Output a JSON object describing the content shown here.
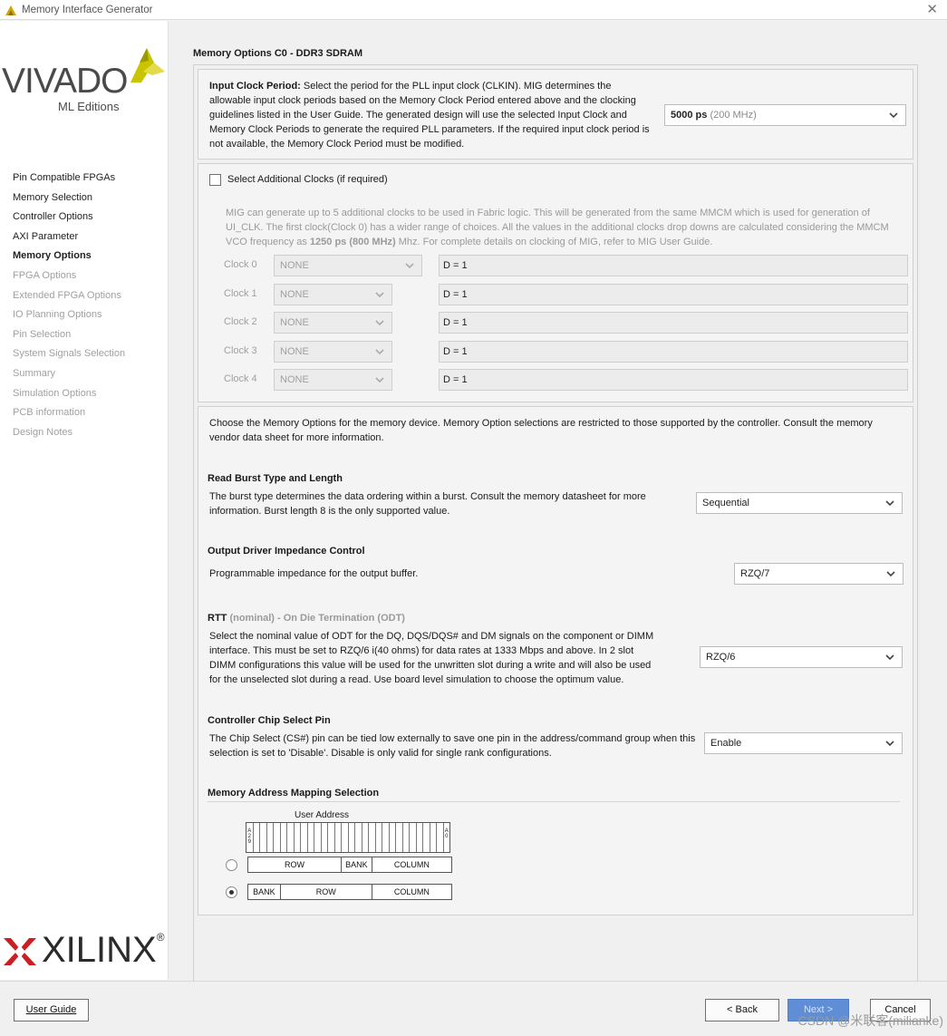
{
  "window": {
    "title": "Memory Interface Generator",
    "close_glyph": "✕"
  },
  "brand": {
    "product": "VIVADO",
    "edition": "ML Editions",
    "company": "XILINX",
    "registered": "®"
  },
  "sidebar": {
    "items": [
      {
        "label": "Pin Compatible FPGAs",
        "state": "enabled"
      },
      {
        "label": "Memory Selection",
        "state": "enabled"
      },
      {
        "label": "Controller Options",
        "state": "enabled"
      },
      {
        "label": "AXI Parameter",
        "state": "enabled"
      },
      {
        "label": "Memory Options",
        "state": "active"
      },
      {
        "label": "FPGA Options",
        "state": "disabled"
      },
      {
        "label": "Extended FPGA Options",
        "state": "disabled"
      },
      {
        "label": "IO Planning Options",
        "state": "disabled"
      },
      {
        "label": "Pin Selection",
        "state": "disabled"
      },
      {
        "label": "System Signals Selection",
        "state": "disabled"
      },
      {
        "label": "Summary",
        "state": "disabled"
      },
      {
        "label": "Simulation Options",
        "state": "disabled"
      },
      {
        "label": "PCB information",
        "state": "disabled"
      },
      {
        "label": "Design Notes",
        "state": "disabled"
      }
    ]
  },
  "page": {
    "heading": "Memory Options C0 - DDR3 SDRAM"
  },
  "input_clock": {
    "label": "Input Clock Period:",
    "description": "Select the period for the PLL input clock (CLKIN). MIG determines the allowable input clock periods based on the Memory Clock Period entered above and the clocking guidelines listed in the User Guide. The generated design will use the selected Input Clock and Memory Clock Periods to generate the required PLL parameters. If the required input clock period is not available, the Memory Clock Period must be modified.",
    "selected_value": "5000 ps",
    "selected_freq": "(200 MHz)"
  },
  "additional_clocks": {
    "checkbox_label": "Select Additional Clocks (if required)",
    "checked": false,
    "desc_part1": "MIG can generate up to 5 additional clocks to be used in Fabric logic. This will be generated from the same MMCM which is used for generation of UI_CLK. The first clock(Clock 0) has a wider range of choices. All the values in the additional clocks drop downs are calculated considering the MMCM VCO frequency as ",
    "desc_bold": "1250 ps (800 MHz)",
    "desc_part2": " Mhz. For complete details on clocking of MIG, refer to MIG User Guide.",
    "clocks": [
      {
        "label": "Clock 0",
        "value": "NONE",
        "divider": "D = 1"
      },
      {
        "label": "Clock 1",
        "value": "NONE",
        "divider": "D = 1"
      },
      {
        "label": "Clock 2",
        "value": "NONE",
        "divider": "D = 1"
      },
      {
        "label": "Clock 3",
        "value": "NONE",
        "divider": "D = 1"
      },
      {
        "label": "Clock 4",
        "value": "NONE",
        "divider": "D = 1"
      }
    ]
  },
  "memory_options": {
    "intro": "Choose the Memory Options for the memory device. Memory Option selections are restricted to those supported by the controller. Consult the memory vendor data sheet for more information.",
    "read_burst": {
      "title": "Read Burst Type and Length",
      "description": "The burst type determines the data ordering within a burst. Consult the memory datasheet for more information. Burst length 8 is the only supported value.",
      "value": "Sequential"
    },
    "output_driver": {
      "title": "Output Driver Impedance Control",
      "description": "Programmable impedance for the output buffer.",
      "value": "RZQ/7"
    },
    "rtt": {
      "title": "RTT",
      "title_suffix": " (nominal) - On Die Termination (ODT)",
      "description": "Select the nominal value of ODT for the DQ, DQS/DQS# and DM signals on the component or DIMM interface. This must be set to RZQ/6 i(40 ohms) for data rates at 1333 Mbps and above. In 2 slot DIMM configurations this value will be used for the unwritten slot during a write and will also be used for the unselected slot during a read. Use board level simulation to choose the optimum value.",
      "value": "RZQ/6"
    },
    "chip_select": {
      "title": "Controller Chip Select Pin",
      "description": "The Chip Select (CS#) pin can be tied low externally to save one pin in the address/command group when this selection is set to 'Disable'. Disable is only valid for single rank configurations.",
      "value": "Enable"
    },
    "address_mapping": {
      "title": "Memory Address Mapping Selection",
      "user_address_label": "User Address",
      "msb_label": "A29",
      "lsb_label": "A0",
      "bit_count": 30,
      "options": [
        {
          "selected": false,
          "segments": [
            "ROW",
            "BANK",
            "COLUMN"
          ]
        },
        {
          "selected": true,
          "segments": [
            "BANK",
            "ROW",
            "COLUMN"
          ]
        }
      ]
    }
  },
  "footer": {
    "user_guide": "User Guide",
    "back": "< Back",
    "next": "Next >",
    "cancel": "Cancel"
  },
  "watermark": "CSDN @米联客(milianke)"
}
